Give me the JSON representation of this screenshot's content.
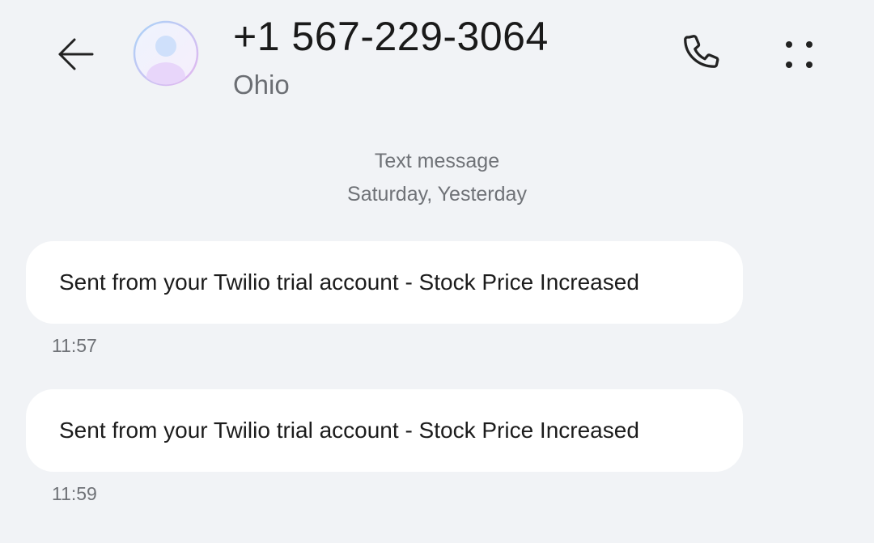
{
  "header": {
    "number": "+1 567-229-3064",
    "location": "Ohio"
  },
  "meta": {
    "type": "Text message",
    "date": "Saturday, Yesterday"
  },
  "messages": [
    {
      "text": "Sent from your Twilio trial account - Stock Price Increased",
      "time": "11:57"
    },
    {
      "text": "Sent from your Twilio trial account - Stock Price Increased",
      "time": "11:59"
    }
  ],
  "icons": {
    "back": "arrow-left-icon",
    "avatar": "person-icon",
    "call": "phone-icon",
    "more": "more-dots-icon"
  },
  "colors": {
    "background": "#f1f3f6",
    "bubble": "#ffffff",
    "secondary_text": "#6f7277"
  }
}
